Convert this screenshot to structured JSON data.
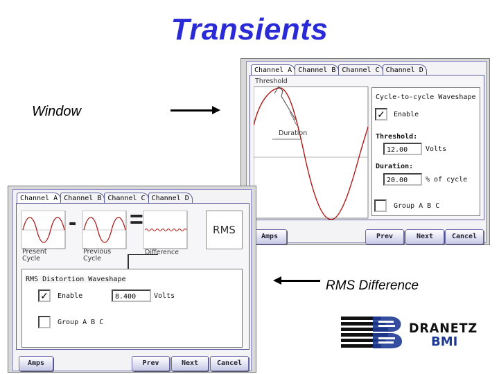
{
  "page": {
    "title": "Transients"
  },
  "captions": {
    "window": "Window",
    "rms_difference": "RMS Difference"
  },
  "tabs": [
    "Channel A",
    "Channel B",
    "Channel C",
    "Channel D"
  ],
  "transient_window": {
    "threshold_label": "Threshold",
    "duration_label": "Duration",
    "group_title": "Cycle-to-cycle Waveshape",
    "enable_label": "Enable",
    "enable_checked": true,
    "threshold_heading": "Threshold:",
    "threshold_value": "12.00",
    "threshold_unit": "Volts",
    "duration_heading": "Duration:",
    "duration_value": "20.00",
    "duration_unit": "% of cycle",
    "group_label": "Group A B C",
    "group_checked": false,
    "buttons": {
      "amps": "Amps",
      "prev": "Prev",
      "next": "Next",
      "cancel": "Cancel"
    }
  },
  "rms_window": {
    "minus": "-",
    "equals": "=",
    "rms": "RMS",
    "present_cycle": "Present\nCycle",
    "previous_cycle": "Previous\nCycle",
    "difference": "Difference",
    "group_title": "RMS Distortion Waveshape",
    "enable_label": "Enable",
    "enable_checked": true,
    "value": "8.400",
    "unit": "Volts",
    "group_label": "Group A B C",
    "group_checked": false,
    "buttons": {
      "amps": "Amps",
      "prev": "Prev",
      "next": "Next",
      "cancel": "Cancel"
    }
  },
  "logo": {
    "brand": "DRANETZ",
    "sub": "BMI"
  },
  "colors": {
    "title": "#2a2ad6",
    "waveform": "#b01818",
    "logo_blue": "#1f3a93"
  }
}
